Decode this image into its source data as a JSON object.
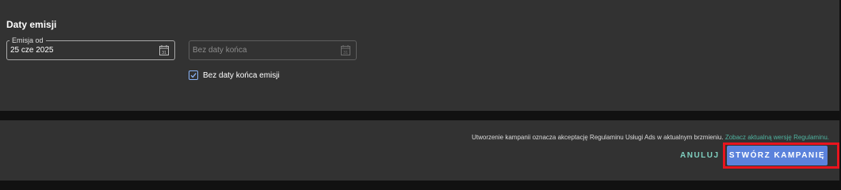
{
  "section": {
    "title": "Daty emisji"
  },
  "date_from": {
    "label": "Emisja od",
    "value": "25 cze 2025",
    "icon": "calendar-icon"
  },
  "date_to": {
    "placeholder": "Bez daty końca",
    "icon": "calendar-icon"
  },
  "no_end_checkbox": {
    "label": "Bez daty końca emisji",
    "checked": true
  },
  "footer": {
    "terms_text": "Utworzenie kampanii oznacza akceptację Regulaminu Usługi Ads w aktualnym brzmieniu.",
    "terms_link": "Zobacz aktualną wersję Regulaminu.",
    "cancel_label": "ANULUJ",
    "create_label": "STWÓRZ KAMPANIĘ"
  },
  "colors": {
    "accent": "#5b82dc",
    "link": "#4fb3a0",
    "highlight": "#e8141e",
    "panel": "#323232"
  }
}
